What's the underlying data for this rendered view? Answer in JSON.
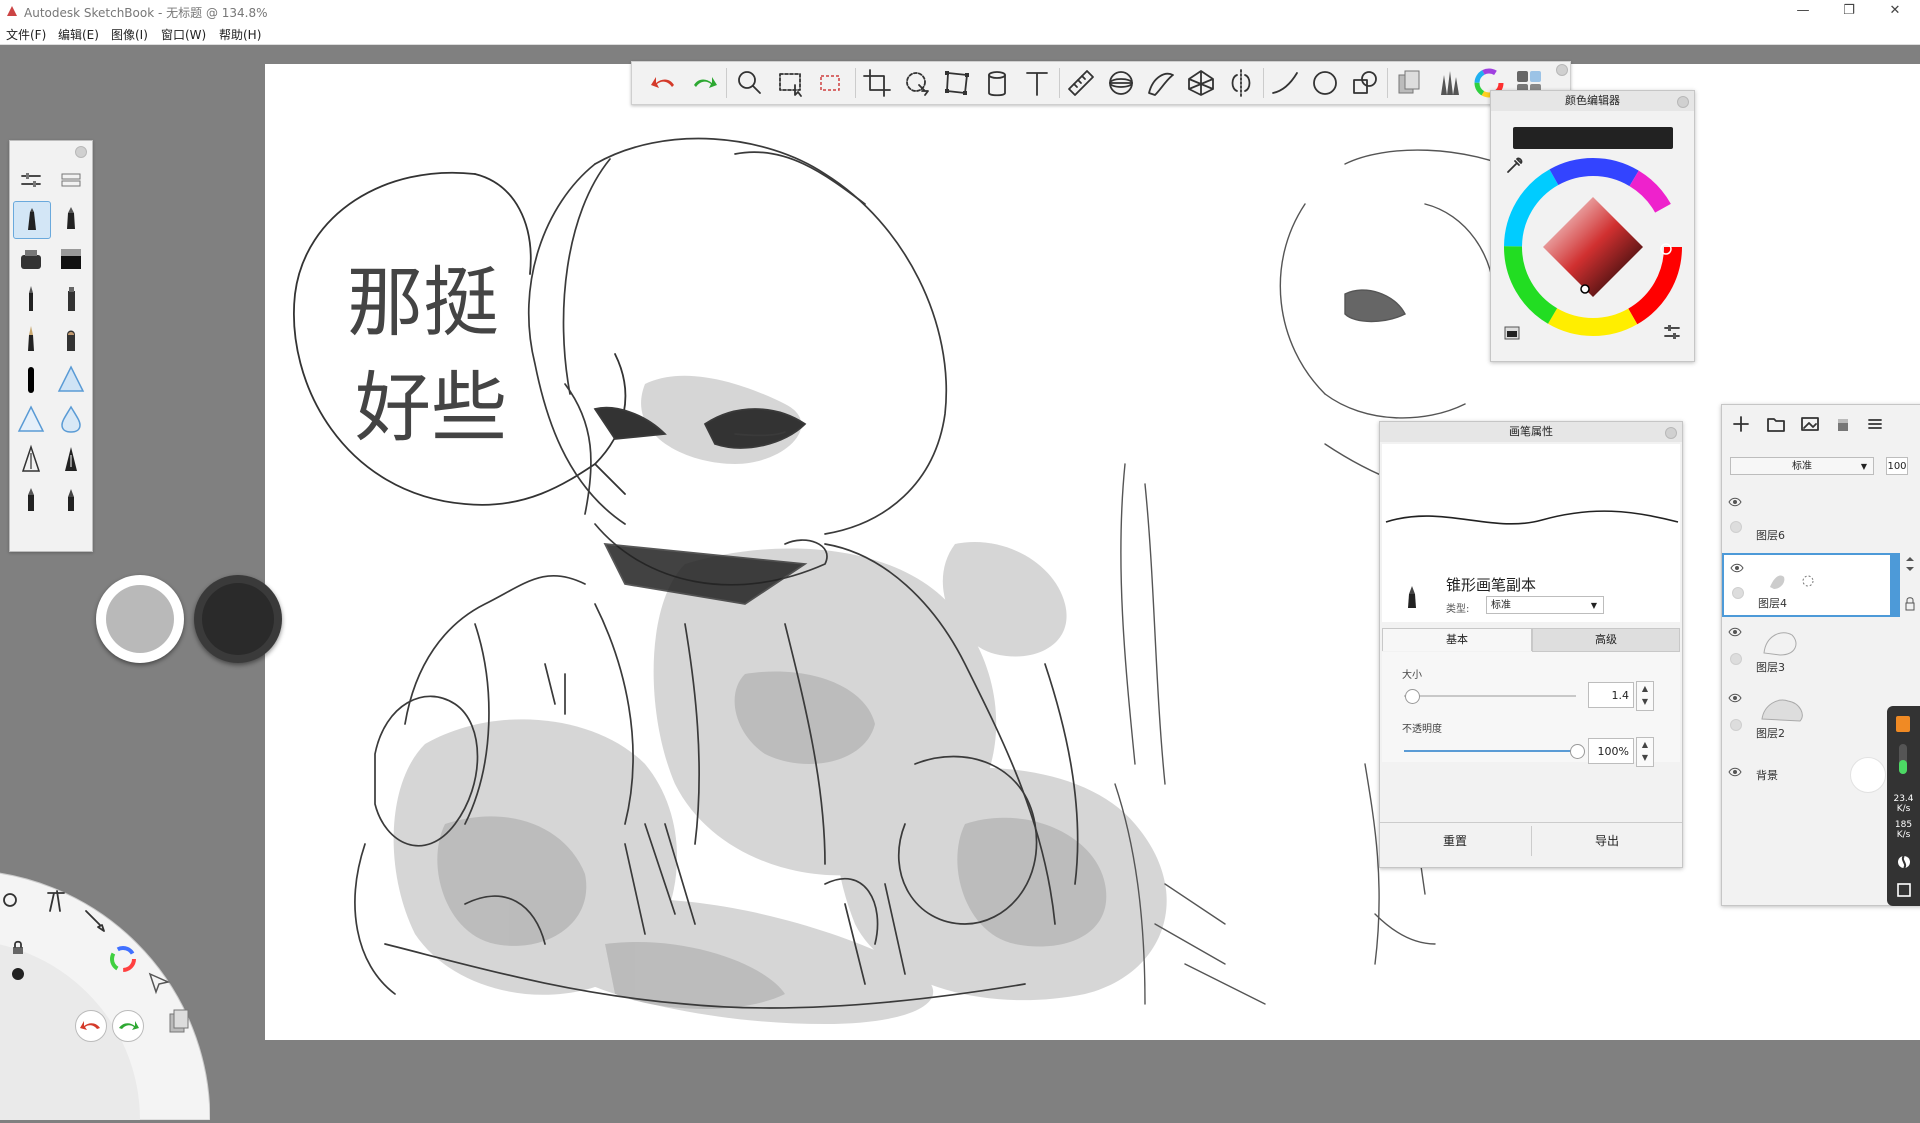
{
  "window": {
    "title": "Autodesk SketchBook - 无标题 @ 134.8%",
    "controls": [
      "minimize",
      "restore",
      "close"
    ]
  },
  "menu": [
    "文件(F)",
    "编辑(E)",
    "图像(I)",
    "窗口(W)",
    "帮助(H)"
  ],
  "toolbar": {
    "tools": [
      "undo-icon",
      "redo-icon",
      "zoom-icon",
      "select-icon",
      "transform-select-icon",
      "crop-icon",
      "lasso-icon",
      "distort-icon",
      "fill-icon",
      "text-icon",
      "ruler-icon",
      "ellipse-guide-icon",
      "french-curve-icon",
      "perspective-icon",
      "symmetry-icon",
      "stroke-icon",
      "circle-icon",
      "shapes-icon",
      "copic-library-icon",
      "brush-library-icon",
      "color-wheel-icon",
      "brush-palette-icon"
    ]
  },
  "canvas_text": {
    "speech_line1": "那挺",
    "speech_line2": "好些"
  },
  "color_editor": {
    "title": "颜色编辑器",
    "current_color": "#222222",
    "hue_accent": "#e03030"
  },
  "brush_properties": {
    "title": "画笔属性",
    "brush_name": "锥形画笔副本",
    "type_label": "类型:",
    "type_value": "标准",
    "tab_basic": "基本",
    "tab_advanced": "高级",
    "size_label": "大小",
    "size_value": "1.4",
    "size_fraction": 0.04,
    "opacity_label": "不透明度",
    "opacity_value": "100%",
    "opacity_fraction": 1.0,
    "reset_button": "重置",
    "export_button": "导出"
  },
  "layer_editor": {
    "blend_mode": "标准",
    "opacity": "100",
    "layers": [
      {
        "name": "图层6",
        "selected": false
      },
      {
        "name": "图层4",
        "selected": true
      },
      {
        "name": "图层3",
        "selected": false
      },
      {
        "name": "图层2",
        "selected": false
      },
      {
        "name": "背景",
        "selected": false
      }
    ]
  },
  "side_widget": {
    "speed1": "23.4",
    "unit1": "K/s",
    "speed2": "185",
    "unit2": "K/s"
  }
}
